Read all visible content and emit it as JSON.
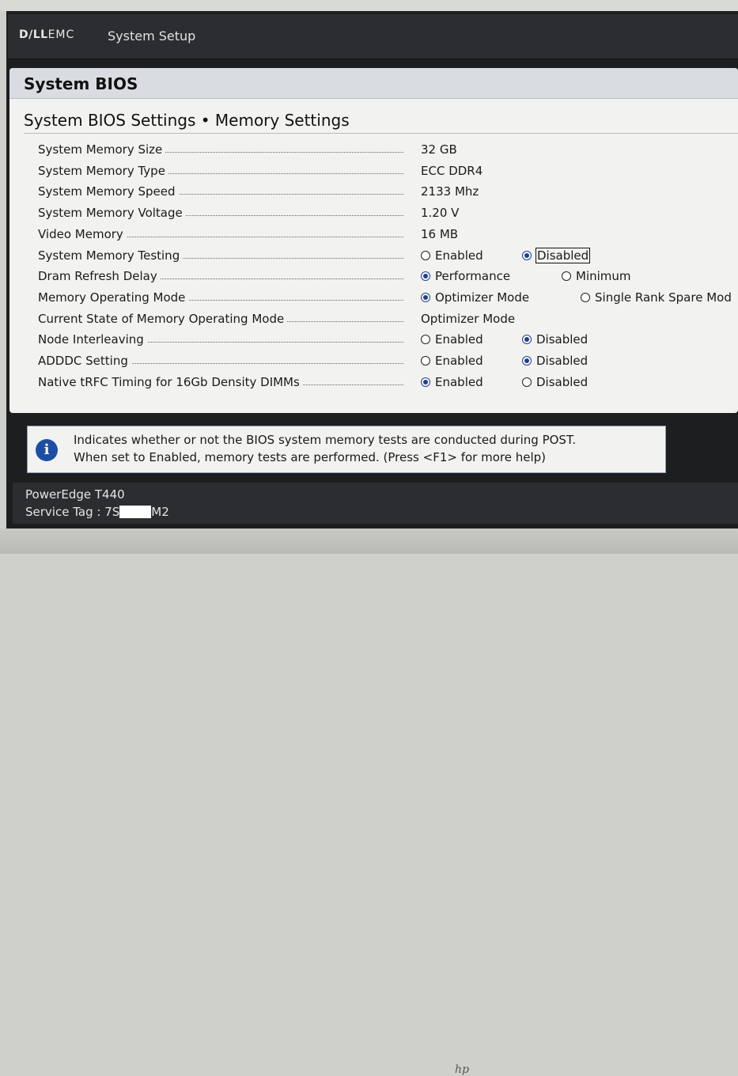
{
  "header": {
    "brand_strong": "D∕LL",
    "brand_light": "EMC",
    "app_title": "System Setup"
  },
  "section_title": "System BIOS",
  "page_title": "System BIOS Settings • Memory Settings",
  "settings": [
    {
      "label": "System Memory Size",
      "value": "32 GB"
    },
    {
      "label": "System Memory Type",
      "value": "ECC DDR4"
    },
    {
      "label": "System Memory Speed",
      "value": "2133 Mhz"
    },
    {
      "label": "System Memory Voltage",
      "value": "1.20 V"
    },
    {
      "label": "Video Memory",
      "value": "16 MB"
    },
    {
      "label": "System Memory Testing",
      "options": [
        "Enabled",
        "Disabled"
      ],
      "selected": "Disabled"
    },
    {
      "label": "Dram Refresh Delay",
      "options": [
        "Performance",
        "Minimum"
      ],
      "selected": "Performance"
    },
    {
      "label": "Memory Operating Mode",
      "options": [
        "Optimizer Mode",
        "Single Rank Spare Mod"
      ],
      "selected": "Optimizer Mode"
    },
    {
      "label": "Current State of Memory Operating Mode",
      "value": "Optimizer Mode"
    },
    {
      "label": "Node Interleaving",
      "options": [
        "Enabled",
        "Disabled"
      ],
      "selected": "Disabled"
    },
    {
      "label": "ADDDC Setting",
      "options": [
        "Enabled",
        "Disabled"
      ],
      "selected": "Disabled"
    },
    {
      "label": "Native tRFC Timing for 16Gb Density DIMMs",
      "options": [
        "Enabled",
        "Disabled"
      ],
      "selected": "Enabled"
    }
  ],
  "help": {
    "line1": "Indicates whether or not the BIOS system memory tests are conducted during POST.",
    "line2": "When set to Enabled, memory tests are performed. (Press <F1> for more help)",
    "icon": "info-icon"
  },
  "footer": {
    "model": "PowerEdge T440",
    "service_tag_prefix": "Service Tag : 7S",
    "service_tag_suffix": "M2"
  },
  "bezel_logo": "hp",
  "colors": {
    "header_bg": "#2b2d31",
    "panel_bg": "#f2f2f0",
    "section_bar": "#d9dde2",
    "radio_selected": "#1f3f8f",
    "info_icon": "#1e4ea3"
  }
}
